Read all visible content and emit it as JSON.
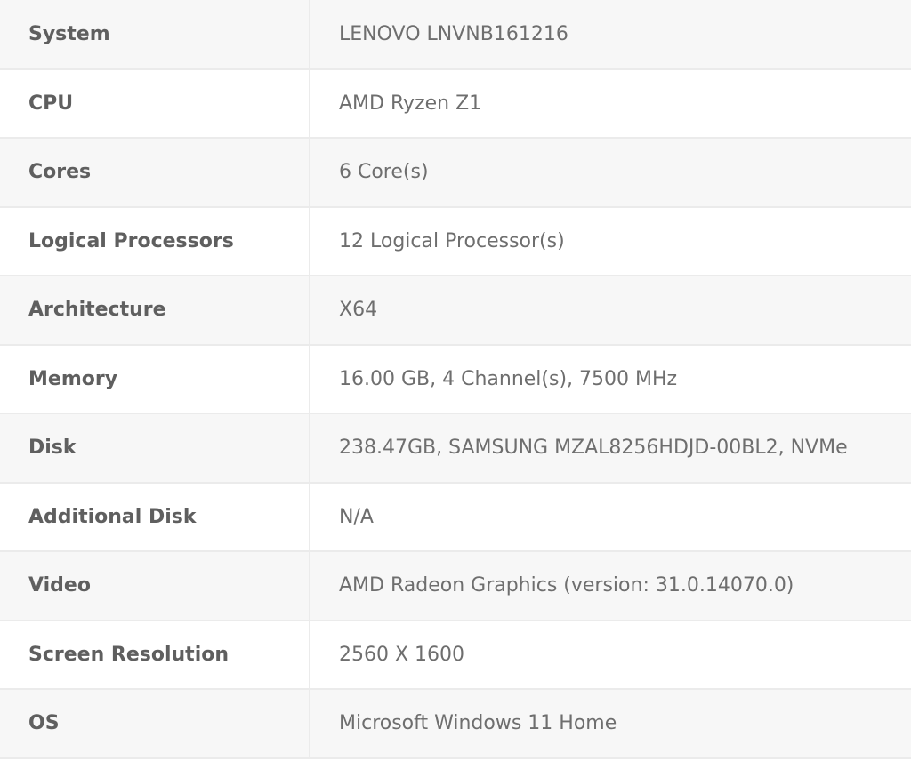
{
  "specs": {
    "rows": [
      {
        "label": "System",
        "value": "LENOVO LNVNB161216"
      },
      {
        "label": "CPU",
        "value": "AMD Ryzen Z1"
      },
      {
        "label": "Cores",
        "value": "6 Core(s)"
      },
      {
        "label": "Logical Processors",
        "value": "12 Logical Processor(s)"
      },
      {
        "label": "Architecture",
        "value": "X64"
      },
      {
        "label": "Memory",
        "value": "16.00 GB, 4 Channel(s), 7500 MHz"
      },
      {
        "label": "Disk",
        "value": "238.47GB, SAMSUNG MZAL8256HDJD-00BL2, NVMe"
      },
      {
        "label": "Additional Disk",
        "value": "N/A"
      },
      {
        "label": "Video",
        "value": "AMD Radeon Graphics (version: 31.0.14070.0)"
      },
      {
        "label": "Screen Resolution",
        "value": "2560 X 1600"
      },
      {
        "label": "OS",
        "value": "Microsoft Windows 11 Home"
      }
    ]
  }
}
